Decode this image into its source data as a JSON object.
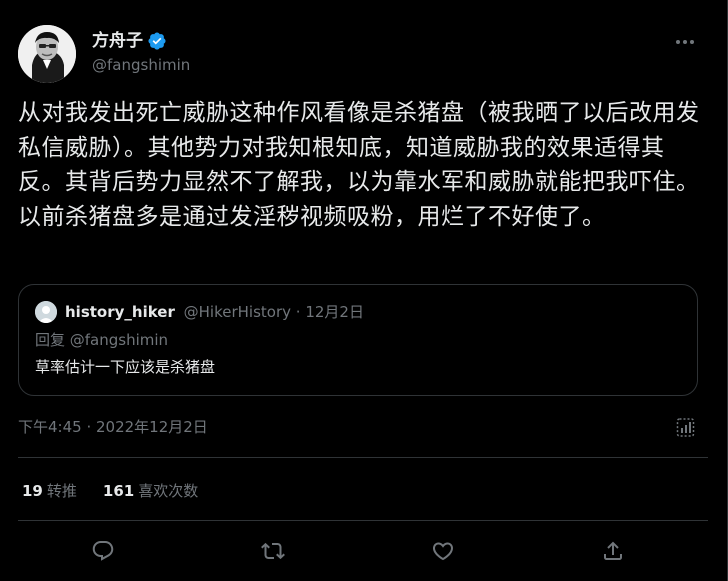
{
  "author": {
    "name": "方舟子",
    "handle": "@fangshimin",
    "verified": true
  },
  "tweet": {
    "text": "从对我发出死亡威胁这种作风看像是杀猪盘（被我晒了以后改用发私信威胁）。其他势力对我知根知底，知道威胁我的效果适得其反。其背后势力显然不了解我，以为靠水军和威胁就能把我吓住。以前杀猪盘多是通过发淫秽视频吸粉，用烂了不好使了。",
    "timestamp": "下午4:45 · 2022年12月2日"
  },
  "quote": {
    "name": "history_hiker",
    "meta": "@HikerHistory · 12月2日",
    "reply_to": "回复 @fangshimin",
    "text": "草率估计一下应该是杀猪盘"
  },
  "stats": {
    "retweets_count": "19",
    "retweets_label": "转推",
    "likes_count": "161",
    "likes_label": "喜欢次数"
  },
  "actions": [
    "reply-icon",
    "retweet-icon",
    "like-icon",
    "share-icon"
  ],
  "colors": {
    "background": "#000000",
    "text": "#e7e9ea",
    "secondary": "#71767b",
    "border": "#2f3336",
    "verified": "#1d9bf0"
  }
}
